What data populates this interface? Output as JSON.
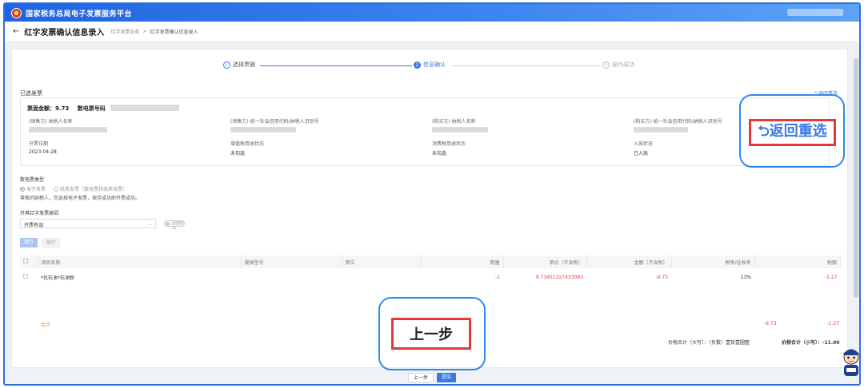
{
  "topbar": {
    "title": "国家税务总局电子发票服务平台"
  },
  "navbar": {
    "back_glyph": "←",
    "page_title": "红字发票确认信息录入",
    "breadcrumb": [
      "红字发票业务",
      "红字发票确认信息录入"
    ]
  },
  "steps": [
    {
      "label": "选择票据",
      "state": "done",
      "glyph": "✓"
    },
    {
      "label": "信息确认",
      "state": "current",
      "glyph": "2"
    },
    {
      "label": "操作成功",
      "state": "todo",
      "glyph": "3"
    }
  ],
  "selected_invoice": {
    "section_title": "已选发票",
    "reselect_small": "⮌返回重选",
    "amount_label": "票面金额：9.73",
    "number_label": "数电票号码",
    "fields": [
      {
        "label": "(销售方) 纳税人名称"
      },
      {
        "label": "(销售方) 统一社会信用代码/纳税人识别号"
      },
      {
        "label": "(购买方) 纳税人名称"
      },
      {
        "label": "(购买方) 统一社会信用代码/纳税人识别号"
      }
    ],
    "row2": [
      {
        "label": "开票日期",
        "value": "2023-04-28"
      },
      {
        "label": "增值税用途状态",
        "value": "未勾选"
      },
      {
        "label": "消费税用途状态",
        "value": "未勾选"
      },
      {
        "label": "入账状态",
        "value": "已入账"
      }
    ]
  },
  "invoice_type": {
    "label": "数电票类型",
    "options": [
      "电子发票",
      "纸质发票（数电票转纸质发票）"
    ],
    "note": "尊敬的纳税人，您选择电子发票，保存成功即开票成功。"
  },
  "reason": {
    "label": "开具红字发票原因",
    "value": "开票有误",
    "toggle": "全部红冲"
  },
  "buttons": {
    "add": "增行",
    "delete": "删行"
  },
  "table": {
    "headers": [
      "项目名称",
      "规格型号",
      "单位",
      "数量",
      "单价（不含税）",
      "金额（不含税）",
      "税率/征收率",
      "税额"
    ],
    "rows": [
      {
        "name": "*化石油*石油粉",
        "spec": "",
        "unit": "",
        "qty": "-1",
        "price": "9.73451327433083",
        "amount": "-9.73",
        "rate": "13%",
        "tax": "-1.27"
      }
    ],
    "sum_label": "合计",
    "sum_amount": "-9.73",
    "sum_tax": "-1.27",
    "total_upper": "价税合计（大写）：（负数）壹拾壹圆整",
    "total_lower": "价税合计（小写）：-11.00"
  },
  "bottom": {
    "prev": "上一步",
    "submit": "提交"
  },
  "callouts": {
    "reselect": "⮌返回重选",
    "prev": "上一步"
  },
  "colors": {
    "primary": "#3a78e8",
    "callout_border": "#2f8bf0",
    "highlight_red": "#e23a3a"
  }
}
